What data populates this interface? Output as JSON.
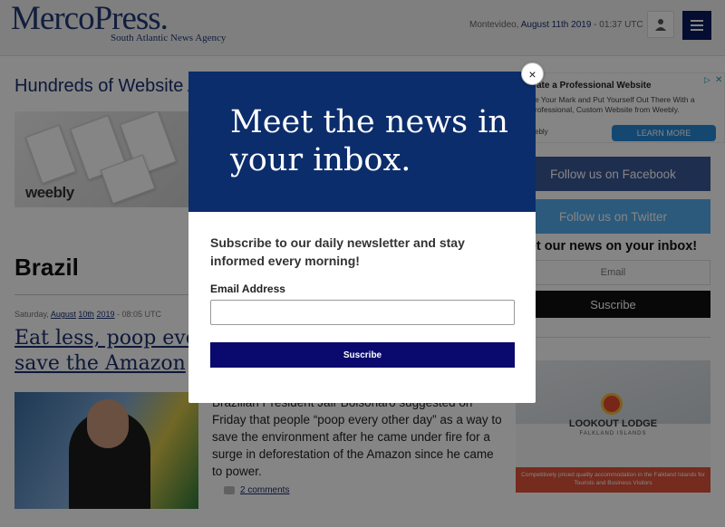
{
  "header": {
    "logo": "MercoPress.",
    "tagline": "South Atlantic News Agency",
    "location": "Montevideo,",
    "date": "August 11th 2019",
    "time": " - 01:37 UTC"
  },
  "left_ad": {
    "title": "Hundreds of Website A",
    "brand": "weebly"
  },
  "section": {
    "title": "Brazil"
  },
  "article": {
    "date_prefix": "Saturday, ",
    "date_month": "August",
    "date_day": "10th",
    "date_year": "2019",
    "date_time": " - 08:05 UTC",
    "headline": "Eat less, poop every other day if you want to save the Amazon",
    "summary": "Brazilian President Jair Bolsonaro suggested on Friday that people “poop every other day” as a way to save the environment after he came under fire for a surge in deforestation of the Amazon since he came to power.",
    "comments": "2 comments"
  },
  "right_ad": {
    "title": "ate a Professional Website",
    "desc": "e Your Mark and Put Yourself Out There With a rofessional, Custom Website from Weebly.",
    "brand": "ebly",
    "cta": "LEARN MORE"
  },
  "social": {
    "facebook": "Follow us on Facebook",
    "twitter": "Follow us on Twitter"
  },
  "sidebar_newsletter": {
    "heading": "et our news on your inbox!",
    "email_placeholder": "Email",
    "button": "Suscribe"
  },
  "lodge_ad": {
    "name": "LOOKOUT LODGE",
    "sub": "FALKLAND ISLANDS",
    "bar": "Competitively priced quality accommodation in the Falkland Islands for Tourists and Business Visitors"
  },
  "modal": {
    "hero": "Meet the news in your inbox.",
    "text": "Subscribe to our daily newsletter and stay informed every morning!",
    "email_label": "Email Address",
    "email_value": "",
    "button": "Suscribe",
    "close": "×"
  },
  "colors": {
    "brand_navy": "#0c2d6b",
    "facebook": "#3b5998",
    "twitter": "#55acee",
    "button_navy": "#0a0a6e"
  }
}
